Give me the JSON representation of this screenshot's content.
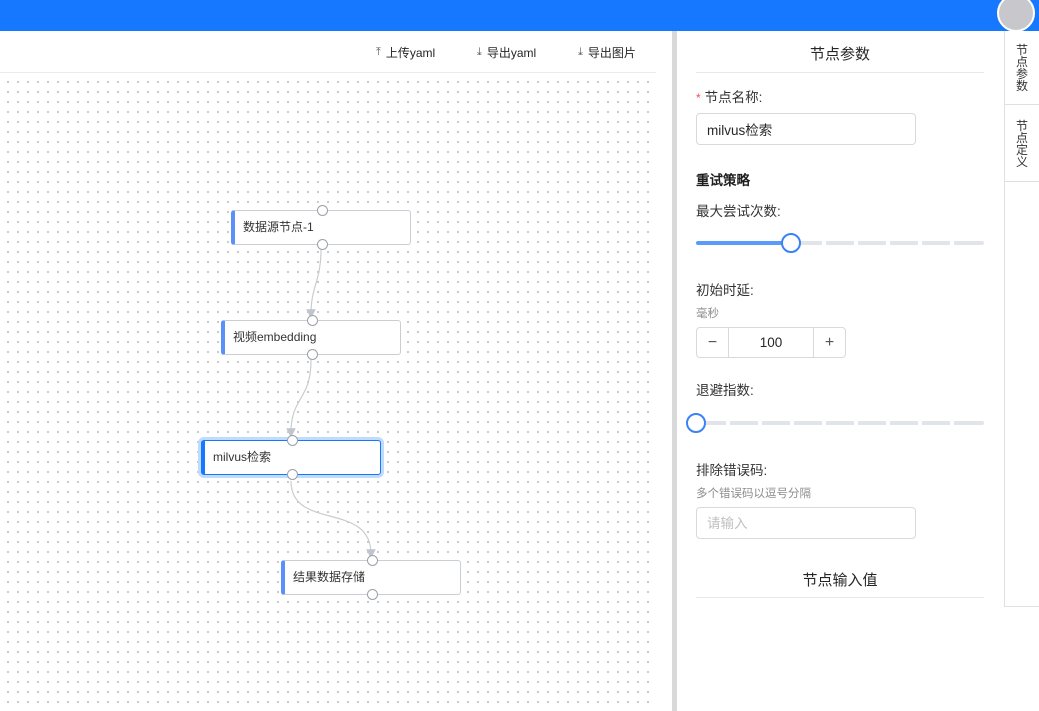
{
  "toolbar": {
    "upload_label": "上传yaml",
    "export_yaml_label": "导出yaml",
    "export_image_label": "导出图片"
  },
  "nodes": [
    {
      "label": "数据源节点-1"
    },
    {
      "label": "视频embedding"
    },
    {
      "label": "milvus检索"
    },
    {
      "label": "结果数据存储"
    }
  ],
  "panel": {
    "title": "节点参数",
    "node_name_label": "节点名称:",
    "node_name_value": "milvus检索",
    "retry_section": "重试策略",
    "max_attempts_label": "最大尝试次数:",
    "max_attempts_level": 0.33,
    "initial_delay_label": "初始时延:",
    "initial_delay_unit": "毫秒",
    "initial_delay_value": "100",
    "backoff_label": "退避指数:",
    "backoff_level": 0.0,
    "exclude_codes_label": "排除错误码:",
    "exclude_codes_hint": "多个错误码以逗号分隔",
    "exclude_codes_placeholder": "请输入",
    "input_section": "节点输入值"
  },
  "vtabs": [
    "节点参数",
    "节点定义"
  ],
  "colors": {
    "topbar": "#1677ff",
    "node_accent": "#5b8ff9",
    "selected_border": "#1677ff",
    "slider_track": "#5b9bf8"
  }
}
